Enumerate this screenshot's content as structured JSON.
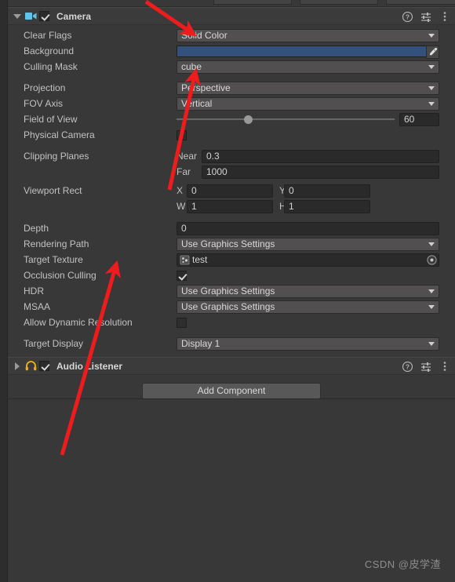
{
  "window": {
    "panel_background": "#383838",
    "accent_red": "#ee1c1c",
    "watermark": "CSDN @皮学渣"
  },
  "components": [
    {
      "name": "camera",
      "title": "Camera",
      "icon": "camera-icon",
      "enabled": true,
      "foldout_open": true,
      "tools": {
        "help": "help-icon",
        "preset": "preset-icon",
        "menu": "kebab-menu-icon"
      },
      "rows": [
        {
          "label": "Clear Flags",
          "type": "dropdown",
          "value": "Solid Color"
        },
        {
          "label": "Background",
          "type": "color",
          "value": "#34517d"
        },
        {
          "label": "Culling Mask",
          "type": "dropdown",
          "value": "cube"
        },
        {
          "label": "Projection",
          "type": "dropdown",
          "value": "Perspective"
        },
        {
          "label": "FOV Axis",
          "type": "dropdown",
          "value": "Vertical"
        },
        {
          "label": "Field of View",
          "type": "slider",
          "value": "60",
          "percent": 33
        },
        {
          "label": "Physical Camera",
          "type": "checkbox",
          "checked": false
        },
        {
          "label": "Clipping Planes",
          "type": "pair",
          "sub": [
            {
              "label": "Near",
              "value": "0.3"
            },
            {
              "label": "Far",
              "value": "1000"
            }
          ]
        },
        {
          "label": "Viewport Rect",
          "type": "rect",
          "sub": [
            {
              "label": "X",
              "value": "0"
            },
            {
              "label": "Y",
              "value": "0"
            },
            {
              "label": "W",
              "value": "1"
            },
            {
              "label": "H",
              "value": "1"
            }
          ]
        },
        {
          "label": "Depth",
          "type": "text",
          "value": "0"
        },
        {
          "label": "Rendering Path",
          "type": "dropdown",
          "value": "Use Graphics Settings"
        },
        {
          "label": "Target Texture",
          "type": "object",
          "value": "test",
          "icon": "render-texture-icon"
        },
        {
          "label": "Occlusion Culling",
          "type": "checkbox",
          "checked": true
        },
        {
          "label": "HDR",
          "type": "dropdown",
          "value": "Use Graphics Settings"
        },
        {
          "label": "MSAA",
          "type": "dropdown",
          "value": "Use Graphics Settings"
        },
        {
          "label": "Allow Dynamic Resolution",
          "type": "checkbox",
          "checked": false
        },
        {
          "label": "Target Display",
          "type": "dropdown",
          "value": "Display 1"
        }
      ]
    },
    {
      "name": "audio-listener",
      "title": "Audio Listener",
      "icon": "headphones-icon",
      "enabled": true,
      "foldout_open": false,
      "tools": {
        "help": "help-icon",
        "preset": "preset-icon",
        "menu": "kebab-menu-icon"
      }
    }
  ],
  "add_component": {
    "label": "Add Component"
  },
  "annotations": [
    {
      "name": "arrow-to-clear-flags",
      "from": [
        186,
        2
      ],
      "to": [
        243,
        41
      ]
    },
    {
      "name": "arrow-to-culling-mask",
      "from": [
        216,
        242
      ],
      "to": [
        248,
        96
      ]
    },
    {
      "name": "arrow-to-target-texture",
      "from": [
        79,
        580
      ],
      "to": [
        147,
        341
      ]
    }
  ]
}
